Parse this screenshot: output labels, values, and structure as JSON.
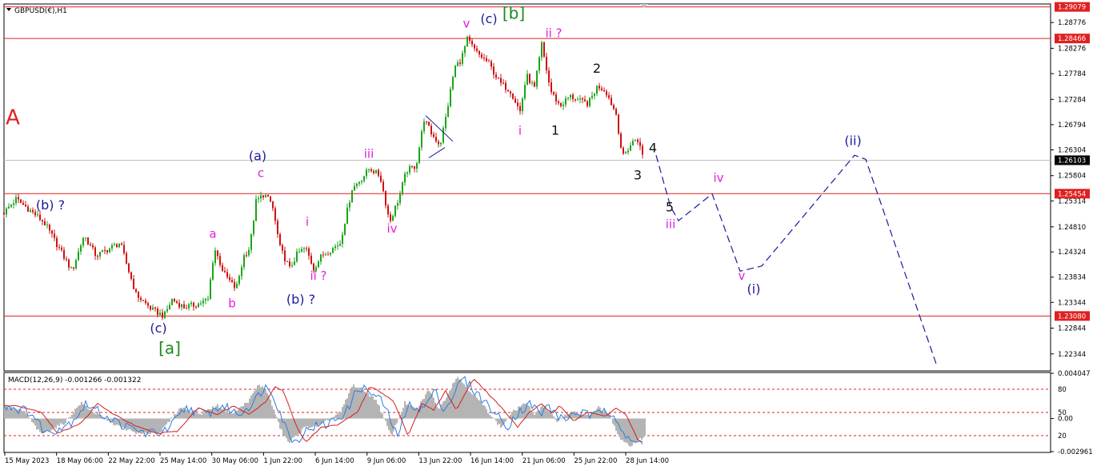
{
  "header": {
    "symbol_label": "GBPUSD(€),H1",
    "indicator_label": "MACD(12,26,9) -0.001266 -0.001322"
  },
  "colors": {
    "bull": "#1aa51a",
    "bear": "#d11010",
    "level": "#e02020",
    "wave_blue": "#1a1a9a",
    "wave_magenta": "#e020e0",
    "wave_green": "#1a8a1a",
    "black": "#111111",
    "macd_hist": "#b4b4b4",
    "macd_main": "#2a7de1",
    "macd_signal": "#d02020"
  },
  "chart_data": {
    "type": "candlestick",
    "price_axis": {
      "ylim": [
        1.2203,
        1.2912
      ],
      "ticks": [
        "1.28776",
        "1.28276",
        "1.27784",
        "1.27284",
        "1.26794",
        "1.26304",
        "1.25804",
        "1.25314",
        "1.24810",
        "1.24324",
        "1.23834",
        "1.23344",
        "1.22844",
        "1.22344"
      ]
    },
    "price_levels": [
      {
        "label": "1.29079",
        "value": 1.29079,
        "style": "level"
      },
      {
        "label": "1.28466",
        "value": 1.28466,
        "style": "level"
      },
      {
        "label": "1.26103",
        "value": 1.26103,
        "style": "current"
      },
      {
        "label": "1.25454",
        "value": 1.25454,
        "style": "level"
      },
      {
        "label": "1.23080",
        "value": 1.2308,
        "style": "level"
      }
    ],
    "time_axis": [
      "15 May 2023",
      "18 May 06:00",
      "22 May 22:00",
      "25 May 14:00",
      "30 May 06:00",
      "1 Jun 22:00",
      "6 Jun 14:00",
      "9 Jun 06:00",
      "13 Jun 22:00",
      "16 Jun 14:00",
      "21 Jun 06:00",
      "25 Jun 22:00",
      "28 Jun 14:00"
    ],
    "price_path": [
      [
        0,
        1.25
      ],
      [
        20,
        1.2535
      ],
      [
        40,
        1.251
      ],
      [
        55,
        1.249
      ],
      [
        70,
        1.245
      ],
      [
        90,
        1.2395
      ],
      [
        105,
        1.2465
      ],
      [
        120,
        1.2425
      ],
      [
        150,
        1.245
      ],
      [
        170,
        1.235
      ],
      [
        190,
        1.232
      ],
      [
        205,
        1.2308
      ],
      [
        215,
        1.234
      ],
      [
        230,
        1.2325
      ],
      [
        245,
        1.233
      ],
      [
        260,
        1.234
      ],
      [
        268,
        1.244
      ],
      [
        280,
        1.239
      ],
      [
        295,
        1.236
      ],
      [
        305,
        1.2425
      ],
      [
        312,
        1.244
      ],
      [
        320,
        1.253
      ],
      [
        330,
        1.2545
      ],
      [
        340,
        1.2525
      ],
      [
        350,
        1.244
      ],
      [
        362,
        1.24
      ],
      [
        372,
        1.243
      ],
      [
        382,
        1.244
      ],
      [
        392,
        1.24
      ],
      [
        402,
        1.2425
      ],
      [
        412,
        1.2435
      ],
      [
        425,
        1.245
      ],
      [
        440,
        1.2555
      ],
      [
        452,
        1.2575
      ],
      [
        462,
        1.2595
      ],
      [
        475,
        1.258
      ],
      [
        487,
        1.249
      ],
      [
        498,
        1.2535
      ],
      [
        508,
        1.259
      ],
      [
        520,
        1.26
      ],
      [
        530,
        1.269
      ],
      [
        540,
        1.266
      ],
      [
        550,
        1.264
      ],
      [
        558,
        1.27
      ],
      [
        568,
        1.279
      ],
      [
        576,
        1.2805
      ],
      [
        584,
        1.2845
      ],
      [
        595,
        1.282
      ],
      [
        610,
        1.28
      ],
      [
        625,
        1.276
      ],
      [
        638,
        1.2745
      ],
      [
        650,
        1.2705
      ],
      [
        658,
        1.2775
      ],
      [
        668,
        1.275
      ],
      [
        677,
        1.2835
      ],
      [
        688,
        1.2745
      ],
      [
        700,
        1.2715
      ],
      [
        712,
        1.2735
      ],
      [
        725,
        1.2725
      ],
      [
        735,
        1.272
      ],
      [
        747,
        1.2755
      ],
      [
        757,
        1.2745
      ],
      [
        770,
        1.27
      ],
      [
        778,
        1.2615
      ],
      [
        788,
        1.264
      ],
      [
        796,
        1.2655
      ],
      [
        805,
        1.261
      ]
    ],
    "macd": {
      "ylim": [
        -0.002961,
        0.004047
      ],
      "ticks": [
        "0.004047",
        "0.00",
        "-0.002961"
      ],
      "levels": [
        "80",
        "50",
        "20"
      ],
      "hist": [
        [
          0,
          0.0012
        ],
        [
          30,
          0.0006
        ],
        [
          50,
          -0.0014
        ],
        [
          80,
          -0.0004
        ],
        [
          100,
          0.0014
        ],
        [
          120,
          0.0004
        ],
        [
          150,
          -0.0008
        ],
        [
          175,
          -0.0014
        ],
        [
          200,
          -0.0012
        ],
        [
          225,
          0.001
        ],
        [
          250,
          0.0004
        ],
        [
          270,
          0.0012
        ],
        [
          290,
          0.0004
        ],
        [
          310,
          0.0016
        ],
        [
          322,
          0.003
        ],
        [
          332,
          0.0026
        ],
        [
          350,
          -0.001
        ],
        [
          360,
          -0.0022
        ],
        [
          380,
          -0.0008
        ],
        [
          400,
          -0.0006
        ],
        [
          425,
          0.0006
        ],
        [
          440,
          0.003
        ],
        [
          452,
          0.0026
        ],
        [
          470,
          0.0016
        ],
        [
          488,
          -0.0016
        ],
        [
          505,
          0.0014
        ],
        [
          520,
          0.0008
        ],
        [
          535,
          0.0026
        ],
        [
          548,
          0.0008
        ],
        [
          560,
          0.0024
        ],
        [
          570,
          0.0038
        ],
        [
          585,
          0.0026
        ],
        [
          605,
          0.001
        ],
        [
          625,
          -0.0008
        ],
        [
          640,
          0.0006
        ],
        [
          655,
          0.0014
        ],
        [
          668,
          0.0004
        ],
        [
          677,
          0.0012
        ],
        [
          695,
          -0.0002
        ],
        [
          712,
          0.0006
        ],
        [
          735,
          0.0002
        ],
        [
          747,
          0.001
        ],
        [
          760,
          0.0004
        ],
        [
          775,
          -0.002
        ],
        [
          788,
          -0.0024
        ],
        [
          805,
          -0.0016
        ]
      ],
      "main_lag": 8,
      "signal_lag": 22
    },
    "projection_path": [
      [
        820,
        1.262
      ],
      [
        838,
        1.252
      ],
      [
        848,
        1.2493
      ],
      [
        890,
        1.2545
      ],
      [
        925,
        1.2395
      ],
      [
        952,
        1.2405
      ],
      [
        1068,
        1.262
      ],
      [
        1082,
        1.2612
      ],
      [
        1170,
        1.2215
      ]
    ],
    "channel_lines": [
      [
        [
          532,
          1.2697
        ],
        [
          566,
          1.2647
        ]
      ],
      [
        [
          536,
          1.2615
        ],
        [
          556,
          1.2635
        ]
      ]
    ],
    "wave_labels": [
      {
        "text": "A",
        "x": 16,
        "y": 1.268,
        "color": "level",
        "size": 26
      },
      {
        "text": "(b) ?",
        "x": 63,
        "y": 1.2515,
        "color": "wave_blue",
        "size": 16
      },
      {
        "text": "(c)",
        "x": 198,
        "y": 1.2276,
        "color": "wave_blue",
        "size": 16
      },
      {
        "text": "[a]",
        "x": 212,
        "y": 1.2235,
        "color": "wave_green",
        "size": 20
      },
      {
        "text": "a",
        "x": 266,
        "y": 1.246,
        "color": "wave_magenta",
        "size": 15
      },
      {
        "text": "b",
        "x": 290,
        "y": 1.2325,
        "color": "wave_magenta",
        "size": 15
      },
      {
        "text": "(a)",
        "x": 322,
        "y": 1.261,
        "color": "wave_blue",
        "size": 16
      },
      {
        "text": "c",
        "x": 326,
        "y": 1.2578,
        "color": "wave_magenta",
        "size": 15
      },
      {
        "text": "(b) ?",
        "x": 376,
        "y": 1.2332,
        "color": "wave_blue",
        "size": 16
      },
      {
        "text": "i",
        "x": 384,
        "y": 1.2483,
        "color": "wave_magenta",
        "size": 15
      },
      {
        "text": "ii ?",
        "x": 398,
        "y": 1.2378,
        "color": "wave_magenta",
        "size": 15
      },
      {
        "text": "iii",
        "x": 461,
        "y": 1.2615,
        "color": "wave_magenta",
        "size": 15
      },
      {
        "text": "iv",
        "x": 490,
        "y": 1.247,
        "color": "wave_magenta",
        "size": 15
      },
      {
        "text": "v",
        "x": 583,
        "y": 1.2868,
        "color": "wave_magenta",
        "size": 15
      },
      {
        "text": "(c)",
        "x": 611,
        "y": 1.2876,
        "color": "wave_blue",
        "size": 16
      },
      {
        "text": "[b]",
        "x": 642,
        "y": 1.2885,
        "color": "wave_green",
        "size": 20
      },
      {
        "text": "ii ?",
        "x": 692,
        "y": 1.2849,
        "color": "wave_magenta",
        "size": 15
      },
      {
        "text": "i",
        "x": 650,
        "y": 1.266,
        "color": "wave_magenta",
        "size": 15
      },
      {
        "text": "1",
        "x": 694,
        "y": 1.266,
        "color": "black",
        "size": 16
      },
      {
        "text": "2",
        "x": 746,
        "y": 1.278,
        "color": "black",
        "size": 16
      },
      {
        "text": "4",
        "x": 816,
        "y": 1.2626,
        "color": "black",
        "size": 16
      },
      {
        "text": "3",
        "x": 797,
        "y": 1.2573,
        "color": "black",
        "size": 16
      },
      {
        "text": "5",
        "x": 837,
        "y": 1.2511,
        "color": "black",
        "size": 16
      },
      {
        "text": "iii",
        "x": 838,
        "y": 1.2478,
        "color": "wave_magenta",
        "size": 15
      },
      {
        "text": "iv",
        "x": 898,
        "y": 1.2568,
        "color": "wave_magenta",
        "size": 15
      },
      {
        "text": "v",
        "x": 927,
        "y": 1.2378,
        "color": "wave_magenta",
        "size": 15
      },
      {
        "text": "(i)",
        "x": 942,
        "y": 1.2352,
        "color": "wave_blue",
        "size": 16
      },
      {
        "text": "(ii)",
        "x": 1066,
        "y": 1.264,
        "color": "wave_blue",
        "size": 16
      }
    ]
  }
}
